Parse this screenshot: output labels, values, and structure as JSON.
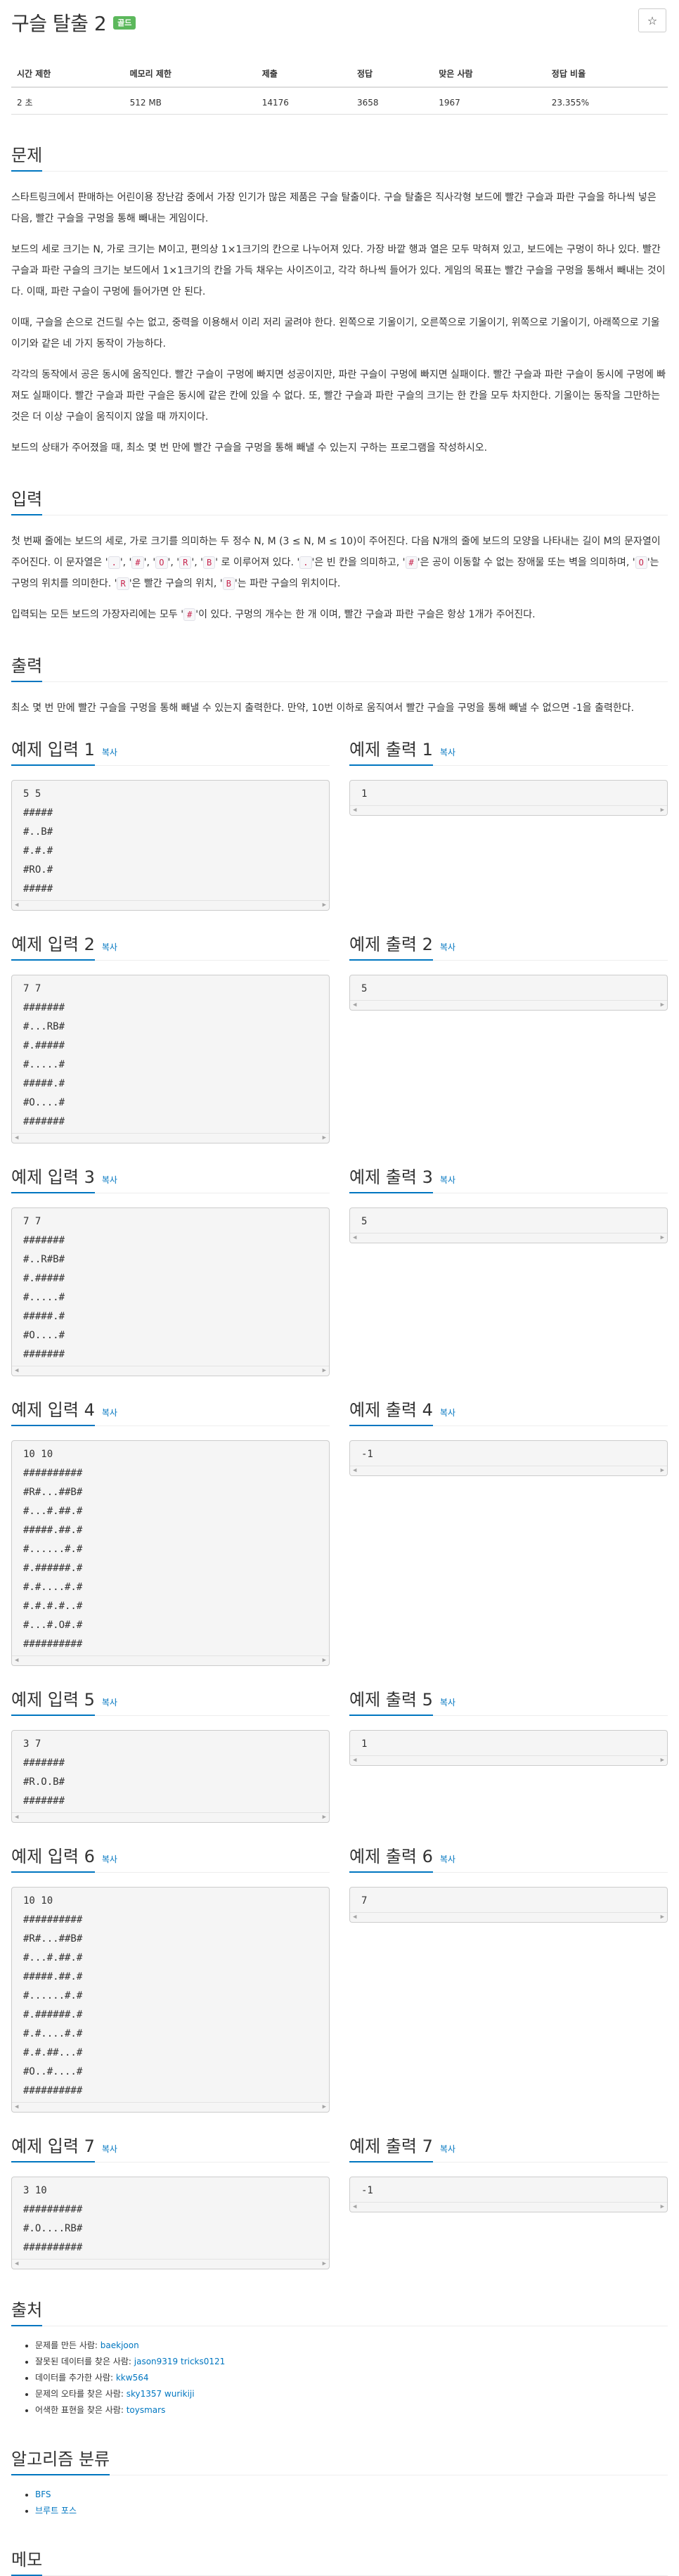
{
  "header": {
    "title": "구슬 탈출 2",
    "badge": "골드",
    "star": "☆"
  },
  "info_table": {
    "headers": [
      "시간 제한",
      "메모리 제한",
      "제출",
      "정답",
      "맞은 사람",
      "정답 비율"
    ],
    "values": [
      "2 초",
      "512 MB",
      "14176",
      "3658",
      "1967",
      "23.355%"
    ]
  },
  "sections": {
    "problem": {
      "title": "문제",
      "paragraphs": [
        "스타트링크에서 판매하는 어린이용 장난감 중에서 가장 인기가 많은 제품은 구슬 탈출이다. 구슬 탈출은 직사각형 보드에 빨간 구슬과 파란 구슬을 하나씩 넣은 다음, 빨간 구슬을 구멍을 통해 빼내는 게임이다.",
        "보드의 세로 크기는 N, 가로 크기는 M이고, 편의상 1×1크기의 칸으로 나누어져 있다. 가장 바깥 행과 열은 모두 막혀져 있고, 보드에는 구멍이 하나 있다. 빨간 구슬과 파란 구슬의 크기는 보드에서 1×1크기의 칸을 가득 채우는 사이즈이고, 각각 하나씩 들어가 있다. 게임의 목표는 빨간 구슬을 구멍을 통해서 빼내는 것이다. 이때, 파란 구슬이 구멍에 들어가면 안 된다.",
        "이때, 구슬을 손으로 건드릴 수는 없고, 중력을 이용해서 이리 저리 굴려야 한다. 왼쪽으로 기울이기, 오른쪽으로 기울이기, 위쪽으로 기울이기, 아래쪽으로 기울이기와 같은 네 가지 동작이 가능하다.",
        "각각의 동작에서 공은 동시에 움직인다. 빨간 구슬이 구멍에 빠지면 성공이지만, 파란 구슬이 구멍에 빠지면 실패이다. 빨간 구슬과 파란 구슬이 동시에 구멍에 빠져도 실패이다. 빨간 구슬과 파란 구슬은 동시에 같은 칸에 있을 수 없다. 또, 빨간 구슬과 파란 구슬의 크기는 한 칸을 모두 차지한다. 기울이는 동작을 그만하는 것은 더 이상 구슬이 움직이지 않을 때 까지이다.",
        "보드의 상태가 주어졌을 때, 최소 몇 번 만에 빨간 구슬을 구멍을 통해 빼낼 수 있는지 구하는 프로그램을 작성하시오."
      ]
    },
    "input": {
      "title": "입력",
      "p1_a": "첫 번째 줄에는 보드의 세로, 가로 크기를 의미하는 두 정수 N, M (3 ≤ N, M ≤ 10)이 주어진다. 다음 N개의 줄에 보드의 모양을 나타내는 길이 M의 문자열이 주어진다. 이 문자열은 '",
      "c_dot": ".",
      "sep1": "', '",
      "c_hash": "#",
      "c_o": "O",
      "c_r": "R",
      "c_b": "B",
      "p1_b": "' 로 이루어져 있다. '",
      "p1_c": "'은 빈 칸을 의미하고, '",
      "p1_d": "'은 공이 이동할 수 없는 장애물 또는 벽을 의미하며, '",
      "p1_e": "'는 구멍의 위치를 의미한다. '",
      "p1_f": "'은 빨간 구슬의 위치, '",
      "p1_g": "'는 파란 구슬의 위치이다.",
      "p2_a": "입력되는 모든 보드의 가장자리에는 모두 '",
      "p2_b": "'이 있다. 구멍의 개수는 한 개 이며, 빨간 구슬과 파란 구슬은 항상 1개가 주어진다."
    },
    "output": {
      "title": "출력",
      "paragraph": "최소 몇 번 만에 빨간 구슬을 구멍을 통해 빼낼 수 있는지 출력한다. 만약, 10번 이하로 움직여서 빨간 구슬을 구멍을 통해 빼낼 수 없으면 -1을 출력한다."
    },
    "source": {
      "title": "출처",
      "items": [
        {
          "prefix": "문제를 만든 사람: ",
          "user": "baekjoon"
        },
        {
          "prefix": "잘못된 데이터를 찾은 사람: ",
          "user": "jason9319 tricks0121"
        },
        {
          "prefix": "데이터를 추가한 사람: ",
          "user": "kkw564"
        },
        {
          "prefix": "문제의 오타를 찾은 사람: ",
          "user": "sky1357 wurikiji"
        },
        {
          "prefix": "어색한 표현을 찾은 사람: ",
          "user": "toysmars"
        }
      ]
    },
    "algorithm": {
      "title": "알고리즘 분류",
      "items": [
        "BFS",
        "브루트 포스"
      ]
    },
    "memo": {
      "title": "메모"
    }
  },
  "copy_label": "복사",
  "samples": [
    {
      "in_title": "예제 입력 1",
      "out_title": "예제 출력 1",
      "input": [
        "5 5",
        "#####",
        "#..B#",
        "#.#.#",
        "#RO.#",
        "#####"
      ],
      "output": [
        "1"
      ]
    },
    {
      "in_title": "예제 입력 2",
      "out_title": "예제 출력 2",
      "input": [
        "7 7",
        "#######",
        "#...RB#",
        "#.#####",
        "#.....#",
        "#####.#",
        "#O....#",
        "#######"
      ],
      "output": [
        "5"
      ]
    },
    {
      "in_title": "예제 입력 3",
      "out_title": "예제 출력 3",
      "input": [
        "7 7",
        "#######",
        "#..R#B#",
        "#.#####",
        "#.....#",
        "#####.#",
        "#O....#",
        "#######"
      ],
      "output": [
        "5"
      ]
    },
    {
      "in_title": "예제 입력 4",
      "out_title": "예제 출력 4",
      "input": [
        "10 10",
        "##########",
        "#R#...##B#",
        "#...#.##.#",
        "#####.##.#",
        "#......#.#",
        "#.######.#",
        "#.#....#.#",
        "#.#.#.#..#",
        "#...#.O#.#",
        "##########"
      ],
      "output": [
        "-1"
      ]
    },
    {
      "in_title": "예제 입력 5",
      "out_title": "예제 출력 5",
      "input": [
        "3 7",
        "#######",
        "#R.O.B#",
        "#######"
      ],
      "output": [
        "1"
      ]
    },
    {
      "in_title": "예제 입력 6",
      "out_title": "예제 출력 6",
      "input": [
        "10 10",
        "##########",
        "#R#...##B#",
        "#...#.##.#",
        "#####.##.#",
        "#......#.#",
        "#.######.#",
        "#.#....#.#",
        "#.#.##...#",
        "#O..#....#",
        "##########"
      ],
      "output": [
        "7"
      ]
    },
    {
      "in_title": "예제 입력 7",
      "out_title": "예제 출력 7",
      "input": [
        "3 10",
        "##########",
        "#.O....RB#",
        "##########"
      ],
      "output": [
        "-1"
      ]
    }
  ]
}
